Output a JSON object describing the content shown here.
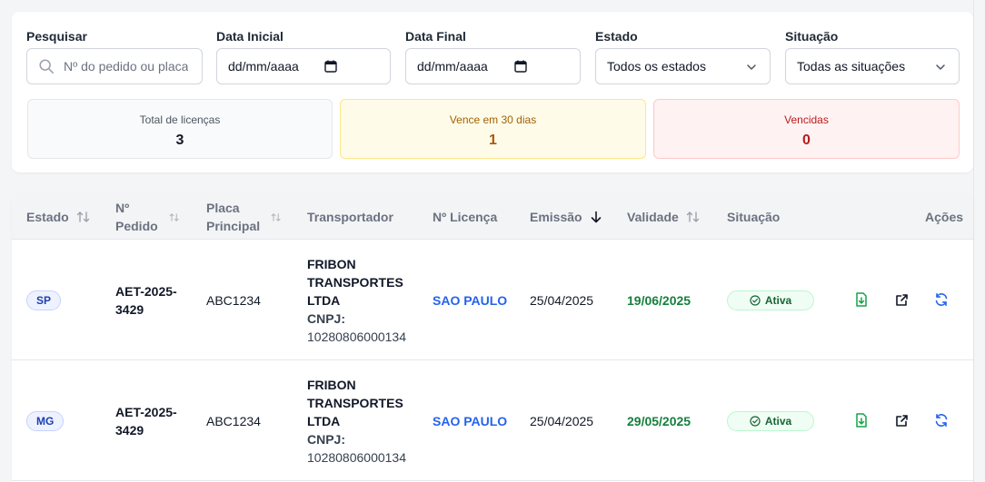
{
  "filters": {
    "search": {
      "label": "Pesquisar",
      "placeholder": "Nº do pedido ou placa"
    },
    "start_date": {
      "label": "Data Inicial",
      "value": "dd/mm/aaaa"
    },
    "end_date": {
      "label": "Data Final",
      "value": "dd/mm/aaaa"
    },
    "state": {
      "label": "Estado",
      "value": "Todos os estados"
    },
    "situation": {
      "label": "Situação",
      "value": "Todas as situações"
    }
  },
  "stats": {
    "total": {
      "label": "Total de licenças",
      "value": "3"
    },
    "expiring": {
      "label": "Vence em 30 dias",
      "value": "1"
    },
    "expired": {
      "label": "Vencidas",
      "value": "0"
    }
  },
  "table": {
    "headers": {
      "state": "Estado",
      "order_line1": "Nº",
      "order_line2": "Pedido",
      "plate_line1": "Placa",
      "plate_line2": "Principal",
      "carrier": "Transportador",
      "license": "Nº Licença",
      "emission": "Emissão",
      "validity": "Validade",
      "situation": "Situação",
      "actions": "Ações"
    },
    "rows": [
      {
        "state": "SP",
        "order_line1": "AET-2025-",
        "order_line2": "3429",
        "plate": "ABC1234",
        "carrier_line1": "FRIBON",
        "carrier_line2": "TRANSPORTES",
        "carrier_line3": "LTDA",
        "cnpj_label": "CNPJ:",
        "cnpj": "10280806000134",
        "license": "SAO PAULO",
        "emission": "25/04/2025",
        "validity": "19/06/2025",
        "status": "Ativa"
      },
      {
        "state": "MG",
        "order_line1": "AET-2025-",
        "order_line2": "3429",
        "plate": "ABC1234",
        "carrier_line1": "FRIBON",
        "carrier_line2": "TRANSPORTES",
        "carrier_line3": "LTDA",
        "cnpj_label": "CNPJ:",
        "cnpj": "10280806000134",
        "license": "SAO PAULO",
        "emission": "25/04/2025",
        "validity": "29/05/2025",
        "status": "Ativa"
      }
    ]
  },
  "icons": {
    "search": "search-icon",
    "calendar": "calendar-icon",
    "chevron": "chevron-down-icon",
    "sort": "sort-icon",
    "sort_desc": "arrow-down-icon",
    "status": "check-circle-icon",
    "download": "file-download-icon",
    "open": "external-link-icon",
    "renew": "refresh-icon"
  },
  "colors": {
    "license_link": "#2563eb",
    "validity_ok": "#15803d",
    "status_active_bg": "#f0fdf4",
    "warning_bg": "#fefce8",
    "danger_bg": "#fef2f2"
  }
}
